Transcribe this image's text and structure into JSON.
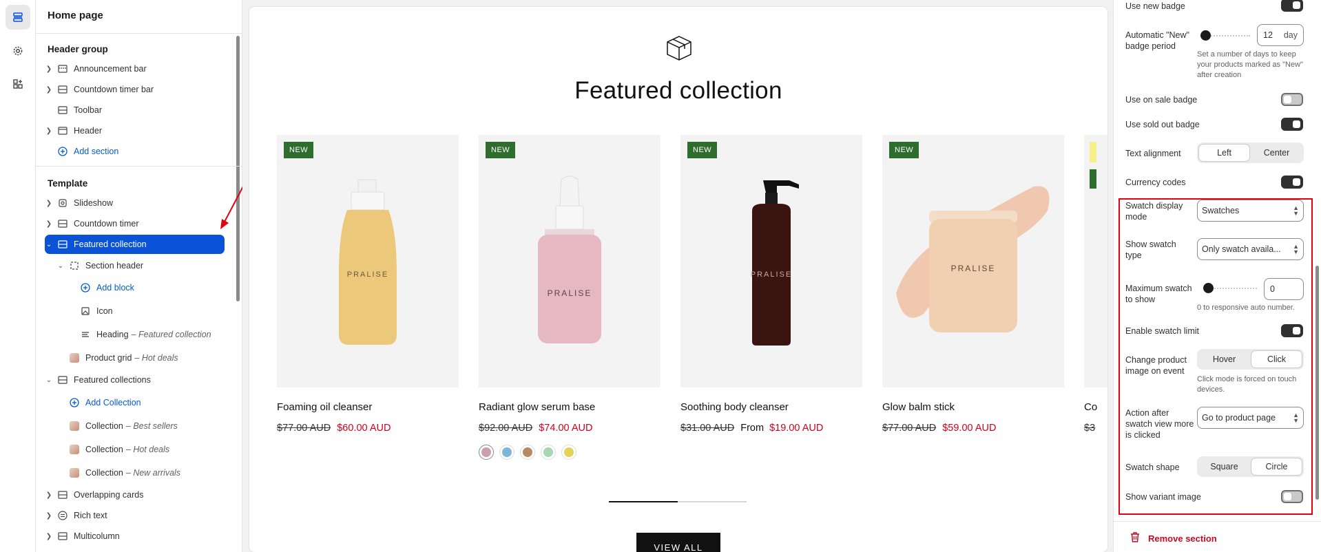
{
  "rail": {
    "items": [
      {
        "name": "sections-icon",
        "active": true
      },
      {
        "name": "gear-icon",
        "active": false
      },
      {
        "name": "apps-icon",
        "active": false
      }
    ]
  },
  "sidebar": {
    "title": "Home page",
    "header_group": {
      "label": "Header group",
      "items": [
        {
          "label": "Announcement bar",
          "icon": "announcement-icon",
          "expandable": true
        },
        {
          "label": "Countdown timer bar",
          "icon": "section-icon",
          "expandable": true
        },
        {
          "label": "Toolbar",
          "icon": "section-icon",
          "expandable": false
        },
        {
          "label": "Header",
          "icon": "header-icon",
          "expandable": true
        }
      ],
      "add_label": "Add section"
    },
    "template": {
      "label": "Template",
      "items": [
        {
          "label": "Slideshow",
          "sub": "",
          "icon": "slideshow-icon"
        },
        {
          "label": "Countdown timer",
          "sub": "",
          "icon": "section-icon"
        },
        {
          "label": "Featured collection",
          "sub": "",
          "icon": "section-icon",
          "selected": true
        },
        {
          "label": "Section header",
          "sub": "",
          "icon": "section-header-icon"
        },
        {
          "label": "Add block",
          "sub": "",
          "icon": "plus-circle-icon"
        },
        {
          "label": "Icon",
          "sub": "",
          "icon": "image-icon"
        },
        {
          "label": "Heading",
          "sub": "– Featured collection",
          "icon": "text-icon"
        },
        {
          "label": "Product grid",
          "sub": "– Hot deals",
          "icon": "thumbnail"
        },
        {
          "label": "Featured collections",
          "sub": "",
          "icon": "section-icon"
        },
        {
          "label": "Add Collection",
          "sub": "",
          "icon": "plus-circle-icon"
        },
        {
          "label": "Collection",
          "sub": "– Best sellers",
          "icon": "thumbnail"
        },
        {
          "label": "Collection",
          "sub": "– Hot deals",
          "icon": "thumbnail"
        },
        {
          "label": "Collection",
          "sub": "– New arrivals",
          "icon": "thumbnail"
        },
        {
          "label": "Overlapping cards",
          "sub": "",
          "icon": "section-icon"
        },
        {
          "label": "Rich text",
          "sub": "",
          "icon": "rich-text-icon"
        },
        {
          "label": "Multicolumn",
          "sub": "",
          "icon": "section-icon"
        }
      ]
    }
  },
  "preview": {
    "title": "Featured collection",
    "icon": "box-icon",
    "products": [
      {
        "badge": "NEW",
        "name": "Foaming oil cleanser",
        "old_price": "$77.00 AUD",
        "from": "",
        "price": "$60.00 AUD",
        "brand": "PRALISE",
        "swatches": []
      },
      {
        "badge": "NEW",
        "name": "Radiant glow serum base",
        "old_price": "$92.00 AUD",
        "from": "",
        "price": "$74.00 AUD",
        "brand": "PRALISE",
        "swatches": [
          "#c9a0ac",
          "#7fb6d6",
          "#b58b66",
          "#a8d6b2",
          "#e3d35a"
        ]
      },
      {
        "badge": "NEW",
        "name": "Soothing body cleanser",
        "old_price": "$31.00 AUD",
        "from": "From",
        "price": "$19.00 AUD",
        "brand": "PRALISE",
        "swatches": []
      },
      {
        "badge": "NEW",
        "name": "Glow balm stick",
        "old_price": "$77.00 AUD",
        "from": "",
        "price": "$59.00 AUD",
        "brand": "PRALISE",
        "swatches": []
      }
    ],
    "peek_name": "Co",
    "peek_price": "$3",
    "progress": 0.5,
    "view_all": "VIEW ALL"
  },
  "settings": {
    "use_new_badge": {
      "label": "Use new badge",
      "on": true
    },
    "auto_new": {
      "label": "Automatic \"New\" badge period",
      "value": "12",
      "unit": "day",
      "help": "Set a number of days to keep your products marked as \"New\" after creation"
    },
    "use_sale_badge": {
      "label": "Use on sale badge",
      "on": false
    },
    "use_sold_out_badge": {
      "label": "Use sold out badge",
      "on": true
    },
    "text_alignment": {
      "label": "Text alignment",
      "options": [
        "Left",
        "Center"
      ],
      "selected": "Left"
    },
    "currency_codes": {
      "label": "Currency codes",
      "on": true
    },
    "swatch_display_mode": {
      "label": "Swatch display mode",
      "value": "Swatches"
    },
    "show_swatch_type": {
      "label": "Show swatch type",
      "value": "Only swatch availa..."
    },
    "max_swatch": {
      "label": "Maximum swatch to show",
      "value": "0",
      "help": "0 to responsive auto number."
    },
    "enable_swatch_limit": {
      "label": "Enable swatch limit",
      "on": true
    },
    "change_image_event": {
      "label": "Change product image on event",
      "options": [
        "Hover",
        "Click"
      ],
      "selected": "Click",
      "help": "Click mode is forced on touch devices."
    },
    "action_after": {
      "label": "Action after swatch view more is clicked",
      "value": "Go to product page"
    },
    "swatch_shape": {
      "label": "Swatch shape",
      "options": [
        "Square",
        "Circle"
      ],
      "selected": "Circle"
    },
    "show_variant_image": {
      "label": "Show variant image",
      "on": false
    },
    "remove_section": "Remove section"
  },
  "colors": {
    "accent_blue": "#0a52d6",
    "badge_green": "#2f6d2f",
    "sale_red": "#d0021b",
    "highlight_red": "#e3000f"
  }
}
